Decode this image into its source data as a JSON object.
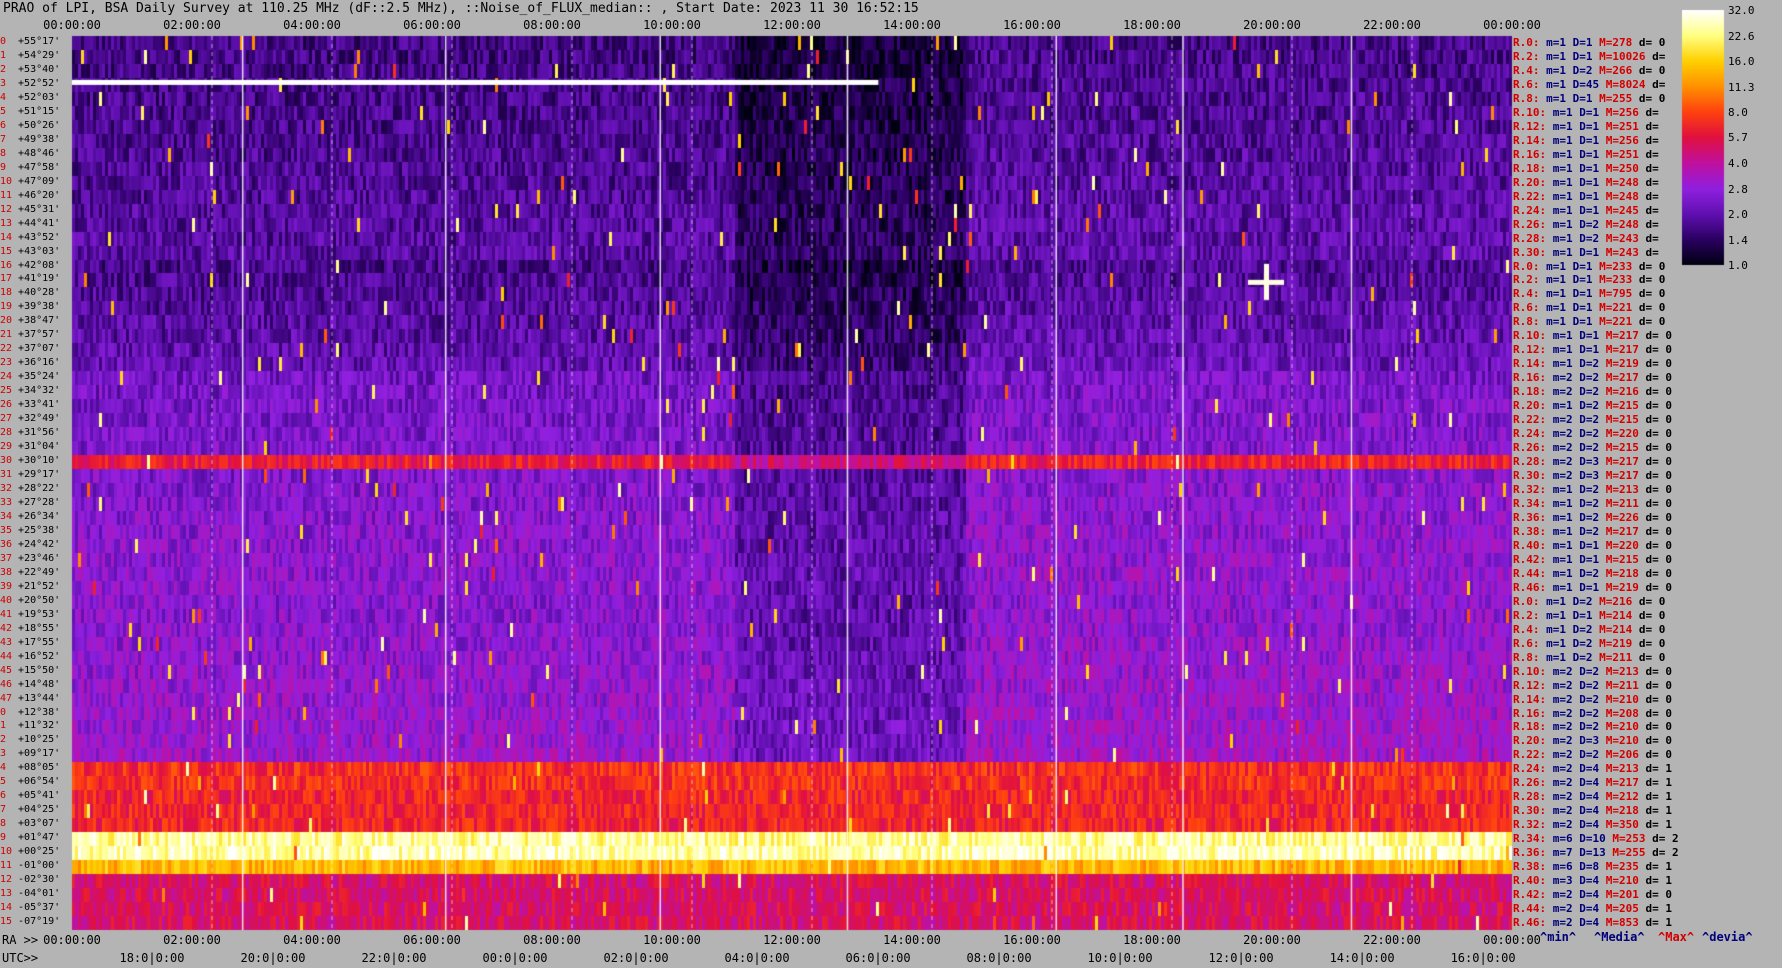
{
  "title": "PRAO of LPI, BSA Daily Survey at 110.25 MHz (dF::2.5 MHz), ::Noise_of_FLUX_median:: , Start Date: 2023 11 30 16:52:15",
  "chart_data": {
    "type": "heatmap",
    "title": "PRAO of LPI, BSA Daily Survey at 110.25 MHz (dF::2.5 MHz), ::Noise_of_FLUX_median:: , Start Date: 2023 11 30 16:52:15",
    "x_top_ticks": [
      "00:00:00",
      "02:00:00",
      "04:00:00",
      "06:00:00",
      "08:00:00",
      "10:00:00",
      "12:00:00",
      "14:00:00",
      "16:00:00",
      "18:00:00",
      "20:00:00",
      "22:00:00",
      "00:00:00"
    ],
    "ra_label": "RA >>",
    "ra_ticks": [
      "00:00:00",
      "02:00:00",
      "04:00:00",
      "06:00:00",
      "08:00:00",
      "10:00:00",
      "12:00:00",
      "14:00:00",
      "16:00:00",
      "18:00:00",
      "20:00:00",
      "22:00:00",
      "00:00:00"
    ],
    "utc_label": "UTC>>",
    "utc_ticks": [
      "18:0|0:00",
      "20:0|0:00",
      "22:0|0:00",
      "00:0|0:00",
      "02:0|0:00",
      "04:0|0:00",
      "06:0|0:00",
      "08:0|0:00",
      "10:0|0:00",
      "12:0|0:00",
      "14:0|0:00",
      "16:0|0:00"
    ],
    "y_labels": [
      {
        "i": "0",
        "d": "+55°17'"
      },
      {
        "i": "1",
        "d": "+54°29'"
      },
      {
        "i": "2",
        "d": "+53°40'"
      },
      {
        "i": "3",
        "d": "+52°52'"
      },
      {
        "i": "4",
        "d": "+52°03'"
      },
      {
        "i": "5",
        "d": "+51°15'"
      },
      {
        "i": "6",
        "d": "+50°26'"
      },
      {
        "i": "7",
        "d": "+49°38'"
      },
      {
        "i": "8",
        "d": "+48°46'"
      },
      {
        "i": "9",
        "d": "+47°58'"
      },
      {
        "i": "10",
        "d": "+47°09'"
      },
      {
        "i": "11",
        "d": "+46°20'"
      },
      {
        "i": "12",
        "d": "+45°31'"
      },
      {
        "i": "13",
        "d": "+44°41'"
      },
      {
        "i": "14",
        "d": "+43°52'"
      },
      {
        "i": "15",
        "d": "+43°03'"
      },
      {
        "i": "16",
        "d": "+42°08'"
      },
      {
        "i": "17",
        "d": "+41°19'"
      },
      {
        "i": "18",
        "d": "+40°28'"
      },
      {
        "i": "19",
        "d": "+39°38'"
      },
      {
        "i": "20",
        "d": "+38°47'"
      },
      {
        "i": "21",
        "d": "+37°57'"
      },
      {
        "i": "22",
        "d": "+37°07'"
      },
      {
        "i": "23",
        "d": "+36°16'"
      },
      {
        "i": "24",
        "d": "+35°24'"
      },
      {
        "i": "25",
        "d": "+34°32'"
      },
      {
        "i": "26",
        "d": "+33°41'"
      },
      {
        "i": "27",
        "d": "+32°49'"
      },
      {
        "i": "28",
        "d": "+31°56'"
      },
      {
        "i": "29",
        "d": "+31°04'"
      },
      {
        "i": "30",
        "d": "+30°10'"
      },
      {
        "i": "31",
        "d": "+29°17'"
      },
      {
        "i": "32",
        "d": "+28°22'"
      },
      {
        "i": "33",
        "d": "+27°28'"
      },
      {
        "i": "34",
        "d": "+26°34'"
      },
      {
        "i": "35",
        "d": "+25°38'"
      },
      {
        "i": "36",
        "d": "+24°42'"
      },
      {
        "i": "37",
        "d": "+23°46'"
      },
      {
        "i": "38",
        "d": "+22°49'"
      },
      {
        "i": "39",
        "d": "+21°52'"
      },
      {
        "i": "40",
        "d": "+20°50'"
      },
      {
        "i": "41",
        "d": "+19°53'"
      },
      {
        "i": "42",
        "d": "+18°55'"
      },
      {
        "i": "43",
        "d": "+17°55'"
      },
      {
        "i": "44",
        "d": "+16°52'"
      },
      {
        "i": "45",
        "d": "+15°50'"
      },
      {
        "i": "46",
        "d": "+14°48'"
      },
      {
        "i": "47",
        "d": "+13°44'"
      },
      {
        "i": "0",
        "d": "+12°38'"
      },
      {
        "i": "1",
        "d": "+11°32'"
      },
      {
        "i": "2",
        "d": "+10°25'"
      },
      {
        "i": "3",
        "d": "+09°17'"
      },
      {
        "i": "4",
        "d": "+08°05'"
      },
      {
        "i": "5",
        "d": "+06°54'"
      },
      {
        "i": "6",
        "d": "+05°41'"
      },
      {
        "i": "7",
        "d": "+04°25'"
      },
      {
        "i": "8",
        "d": "+03°07'"
      },
      {
        "i": "9",
        "d": "+01°47'"
      },
      {
        "i": "10",
        "d": "+00°25'"
      },
      {
        "i": "11",
        "d": "-01°00'"
      },
      {
        "i": "12",
        "d": "-02°30'"
      },
      {
        "i": "13",
        "d": "-04°01'"
      },
      {
        "i": "14",
        "d": "-05°37'"
      },
      {
        "i": "15",
        "d": "-07°19'"
      }
    ],
    "right_stats": [
      {
        "r": "R.0:",
        "m": "m=1",
        "d": "D=1",
        "h": "M=278",
        "v": "d= 0"
      },
      {
        "r": "R.2:",
        "m": "m=1",
        "d": "D=1",
        "h": "M=10026",
        "v": "d="
      },
      {
        "r": "R.4:",
        "m": "m=1",
        "d": "D=2",
        "h": "M=266",
        "v": "d= 0"
      },
      {
        "r": "R.6:",
        "m": "m=1",
        "d": "D=45",
        "h": "M=8024",
        "v": "d="
      },
      {
        "r": "R.8:",
        "m": "m=1",
        "d": "D=1",
        "h": "M=255",
        "v": "d= 0"
      },
      {
        "r": "R.10:",
        "m": "m=1",
        "d": "D=1",
        "h": "M=256",
        "v": "d="
      },
      {
        "r": "R.12:",
        "m": "m=1",
        "d": "D=1",
        "h": "M=251",
        "v": "d="
      },
      {
        "r": "R.14:",
        "m": "m=1",
        "d": "D=1",
        "h": "M=256",
        "v": "d="
      },
      {
        "r": "R.16:",
        "m": "m=1",
        "d": "D=1",
        "h": "M=251",
        "v": "d="
      },
      {
        "r": "R.18:",
        "m": "m=1",
        "d": "D=1",
        "h": "M=250",
        "v": "d="
      },
      {
        "r": "R.20:",
        "m": "m=1",
        "d": "D=1",
        "h": "M=248",
        "v": "d="
      },
      {
        "r": "R.22:",
        "m": "m=1",
        "d": "D=1",
        "h": "M=248",
        "v": "d="
      },
      {
        "r": "R.24:",
        "m": "m=1",
        "d": "D=1",
        "h": "M=245",
        "v": "d="
      },
      {
        "r": "R.26:",
        "m": "m=1",
        "d": "D=2",
        "h": "M=248",
        "v": "d="
      },
      {
        "r": "R.28:",
        "m": "m=1",
        "d": "D=2",
        "h": "M=243",
        "v": "d="
      },
      {
        "r": "R.30:",
        "m": "m=1",
        "d": "D=1",
        "h": "M=243",
        "v": "d="
      },
      {
        "r": "R.0:",
        "m": "m=1",
        "d": "D=1",
        "h": "M=233",
        "v": "d= 0"
      },
      {
        "r": "R.2:",
        "m": "m=1",
        "d": "D=1",
        "h": "M=233",
        "v": "d= 0"
      },
      {
        "r": "R.4:",
        "m": "m=1",
        "d": "D=1",
        "h": "M=795",
        "v": "d= 0"
      },
      {
        "r": "R.6:",
        "m": "m=1",
        "d": "D=1",
        "h": "M=221",
        "v": "d= 0"
      },
      {
        "r": "R.8:",
        "m": "m=1",
        "d": "D=1",
        "h": "M=221",
        "v": "d= 0"
      },
      {
        "r": "R.10:",
        "m": "m=1",
        "d": "D=1",
        "h": "M=217",
        "v": "d= 0"
      },
      {
        "r": "R.12:",
        "m": "m=1",
        "d": "D=1",
        "h": "M=217",
        "v": "d= 0"
      },
      {
        "r": "R.14:",
        "m": "m=1",
        "d": "D=2",
        "h": "M=219",
        "v": "d= 0"
      },
      {
        "r": "R.16:",
        "m": "m=2",
        "d": "D=2",
        "h": "M=217",
        "v": "d= 0"
      },
      {
        "r": "R.18:",
        "m": "m=2",
        "d": "D=2",
        "h": "M=216",
        "v": "d= 0"
      },
      {
        "r": "R.20:",
        "m": "m=1",
        "d": "D=2",
        "h": "M=215",
        "v": "d= 0"
      },
      {
        "r": "R.22:",
        "m": "m=2",
        "d": "D=2",
        "h": "M=215",
        "v": "d= 0"
      },
      {
        "r": "R.24:",
        "m": "m=2",
        "d": "D=2",
        "h": "M=220",
        "v": "d= 0"
      },
      {
        "r": "R.26:",
        "m": "m=2",
        "d": "D=2",
        "h": "M=215",
        "v": "d= 0"
      },
      {
        "r": "R.28:",
        "m": "m=2",
        "d": "D=3",
        "h": "M=217",
        "v": "d= 0"
      },
      {
        "r": "R.30:",
        "m": "m=2",
        "d": "D=3",
        "h": "M=217",
        "v": "d= 0"
      },
      {
        "r": "R.32:",
        "m": "m=1",
        "d": "D=2",
        "h": "M=213",
        "v": "d= 0"
      },
      {
        "r": "R.34:",
        "m": "m=1",
        "d": "D=2",
        "h": "M=211",
        "v": "d= 0"
      },
      {
        "r": "R.36:",
        "m": "m=1",
        "d": "D=2",
        "h": "M=226",
        "v": "d= 0"
      },
      {
        "r": "R.38:",
        "m": "m=1",
        "d": "D=2",
        "h": "M=217",
        "v": "d= 0"
      },
      {
        "r": "R.40:",
        "m": "m=1",
        "d": "D=1",
        "h": "M=220",
        "v": "d= 0"
      },
      {
        "r": "R.42:",
        "m": "m=1",
        "d": "D=1",
        "h": "M=215",
        "v": "d= 0"
      },
      {
        "r": "R.44:",
        "m": "m=1",
        "d": "D=2",
        "h": "M=218",
        "v": "d= 0"
      },
      {
        "r": "R.46:",
        "m": "m=1",
        "d": "D=1",
        "h": "M=219",
        "v": "d= 0"
      },
      {
        "r": "R.0:",
        "m": "m=1",
        "d": "D=2",
        "h": "M=216",
        "v": "d= 0"
      },
      {
        "r": "R.2:",
        "m": "m=1",
        "d": "D=1",
        "h": "M=214",
        "v": "d= 0"
      },
      {
        "r": "R.4:",
        "m": "m=1",
        "d": "D=2",
        "h": "M=214",
        "v": "d= 0"
      },
      {
        "r": "R.6:",
        "m": "m=1",
        "d": "D=2",
        "h": "M=219",
        "v": "d= 0"
      },
      {
        "r": "R.8:",
        "m": "m=1",
        "d": "D=2",
        "h": "M=211",
        "v": "d= 0"
      },
      {
        "r": "R.10:",
        "m": "m=2",
        "d": "D=2",
        "h": "M=213",
        "v": "d= 0"
      },
      {
        "r": "R.12:",
        "m": "m=2",
        "d": "D=2",
        "h": "M=211",
        "v": "d= 0"
      },
      {
        "r": "R.14:",
        "m": "m=2",
        "d": "D=2",
        "h": "M=210",
        "v": "d= 0"
      },
      {
        "r": "R.16:",
        "m": "m=2",
        "d": "D=2",
        "h": "M=208",
        "v": "d= 0"
      },
      {
        "r": "R.18:",
        "m": "m=2",
        "d": "D=2",
        "h": "M=210",
        "v": "d= 0"
      },
      {
        "r": "R.20:",
        "m": "m=2",
        "d": "D=3",
        "h": "M=210",
        "v": "d= 0"
      },
      {
        "r": "R.22:",
        "m": "m=2",
        "d": "D=2",
        "h": "M=206",
        "v": "d= 0"
      },
      {
        "r": "R.24:",
        "m": "m=2",
        "d": "D=4",
        "h": "M=213",
        "v": "d= 1"
      },
      {
        "r": "R.26:",
        "m": "m=2",
        "d": "D=4",
        "h": "M=217",
        "v": "d= 1"
      },
      {
        "r": "R.28:",
        "m": "m=2",
        "d": "D=4",
        "h": "M=212",
        "v": "d= 1"
      },
      {
        "r": "R.30:",
        "m": "m=2",
        "d": "D=4",
        "h": "M=218",
        "v": "d= 1"
      },
      {
        "r": "R.32:",
        "m": "m=2",
        "d": "D=4",
        "h": "M=350",
        "v": "d= 1"
      },
      {
        "r": "R.34:",
        "m": "m=6",
        "d": "D=10",
        "h": "M=253",
        "v": "d= 2"
      },
      {
        "r": "R.36:",
        "m": "m=7",
        "d": "D=13",
        "h": "M=255",
        "v": "d= 2"
      },
      {
        "r": "R.38:",
        "m": "m=6",
        "d": "D=8",
        "h": "M=235",
        "v": "d= 1"
      },
      {
        "r": "R.40:",
        "m": "m=3",
        "d": "D=4",
        "h": "M=210",
        "v": "d= 1"
      },
      {
        "r": "R.42:",
        "m": "m=2",
        "d": "D=4",
        "h": "M=201",
        "v": "d= 0"
      },
      {
        "r": "R.44:",
        "m": "m=2",
        "d": "D=4",
        "h": "M=205",
        "v": "d= 1"
      },
      {
        "r": "R.46:",
        "m": "m=2",
        "d": "D=4",
        "h": "M=853",
        "v": "d= 1"
      }
    ],
    "legend": {
      "min": "^min^",
      "median": "^Media^",
      "max": "^Max^",
      "devia": "^devia^"
    },
    "colorbar_ticks": [
      "32.0",
      "22.6",
      "16.0",
      "11.3",
      "8.0",
      "5.7",
      "4.0",
      "2.8",
      "2.0",
      "1.4",
      "1.0"
    ],
    "colorbar_range": [
      1.0,
      32.0
    ],
    "colormap": [
      "#000010",
      "#2a0060",
      "#6010b0",
      "#9020e0",
      "#c010a0",
      "#e01040",
      "#ff4010",
      "#ff9000",
      "#ffd000",
      "#ffff80",
      "#ffffff"
    ],
    "rows": 64,
    "bright_bands": [
      {
        "dec": "+01°47'",
        "level": 24
      },
      {
        "dec": "+00°25'",
        "level": 26
      },
      {
        "dec": "-01°00'",
        "level": 14
      },
      {
        "dec": "+08°05'",
        "level": 7
      },
      {
        "dec": "+06°54'",
        "level": 7
      },
      {
        "dec": "+30°10'",
        "level": 6
      }
    ]
  }
}
